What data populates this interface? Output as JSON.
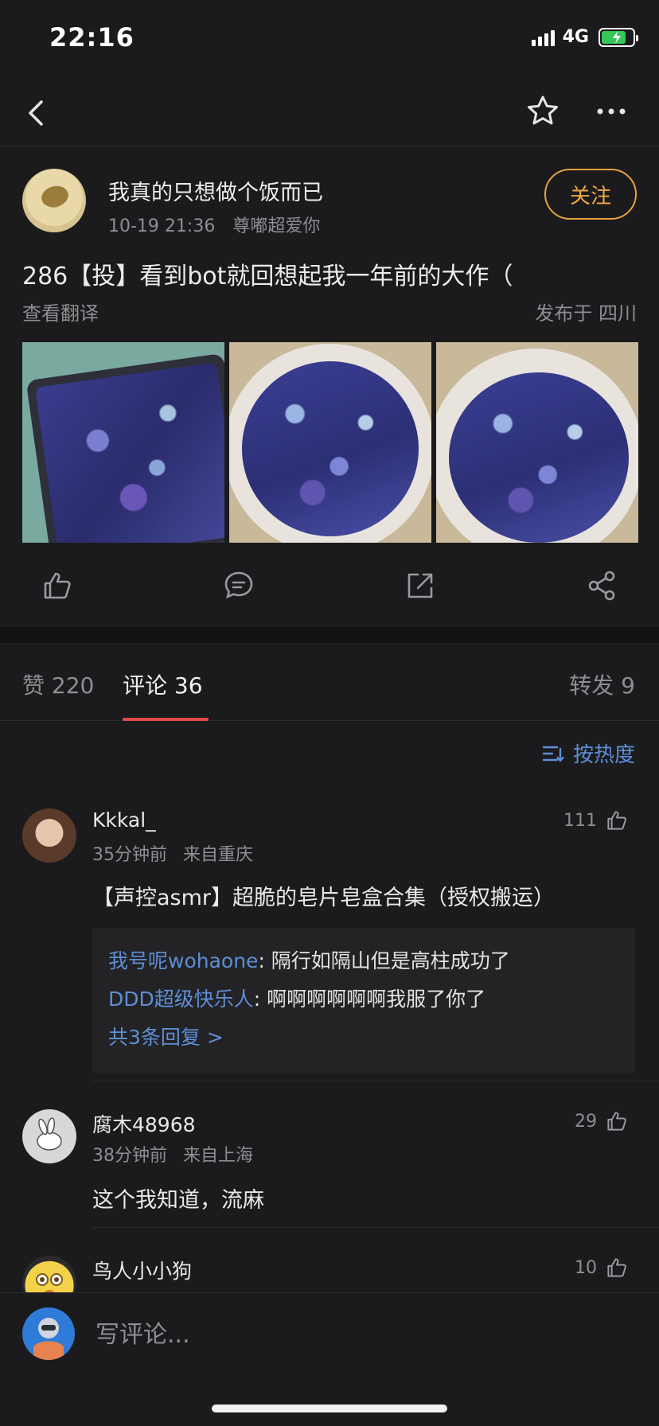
{
  "status_bar": {
    "time": "22:16",
    "network": "4G"
  },
  "post": {
    "author": "我真的只想做个饭而已",
    "time": "10-19 21:36",
    "source": "尊嘟超爱你",
    "follow_label": "关注",
    "text": "286【投】看到bot就回想起我一年前的大作（",
    "translate_label": "查看翻译",
    "location": "发布于 四川"
  },
  "tabs": [
    {
      "label": "赞 220"
    },
    {
      "label": "评论 36"
    },
    {
      "label": "转发 9"
    }
  ],
  "sort_label": "按热度",
  "comments": [
    {
      "name": "Kkkal_",
      "time": "35分钟前",
      "location": "来自重庆",
      "likes": "111",
      "text": "【声控asmr】超脆的皂片皂盒合集（授权搬运）",
      "replies": [
        {
          "user": "我号呢wohaone",
          "text": ": 隔行如隔山但是高柱成功了"
        },
        {
          "user": "DDD超级快乐人",
          "text": ": 啊啊啊啊啊啊我服了你了"
        }
      ],
      "more_replies": "共3条回复 >"
    },
    {
      "name": "腐木48968",
      "time": "38分钟前",
      "location": "来自上海",
      "likes": "29",
      "text": "这个我知道，流麻"
    },
    {
      "name": "鸟人小小狗",
      "likes": "10"
    }
  ],
  "bottom": {
    "placeholder": "写评论..."
  },
  "colors": {
    "accent_orange": "#f0a742",
    "link_blue": "#5d8fd6",
    "tab_indicator": "#e5484d",
    "background": "#1b1b1d"
  }
}
